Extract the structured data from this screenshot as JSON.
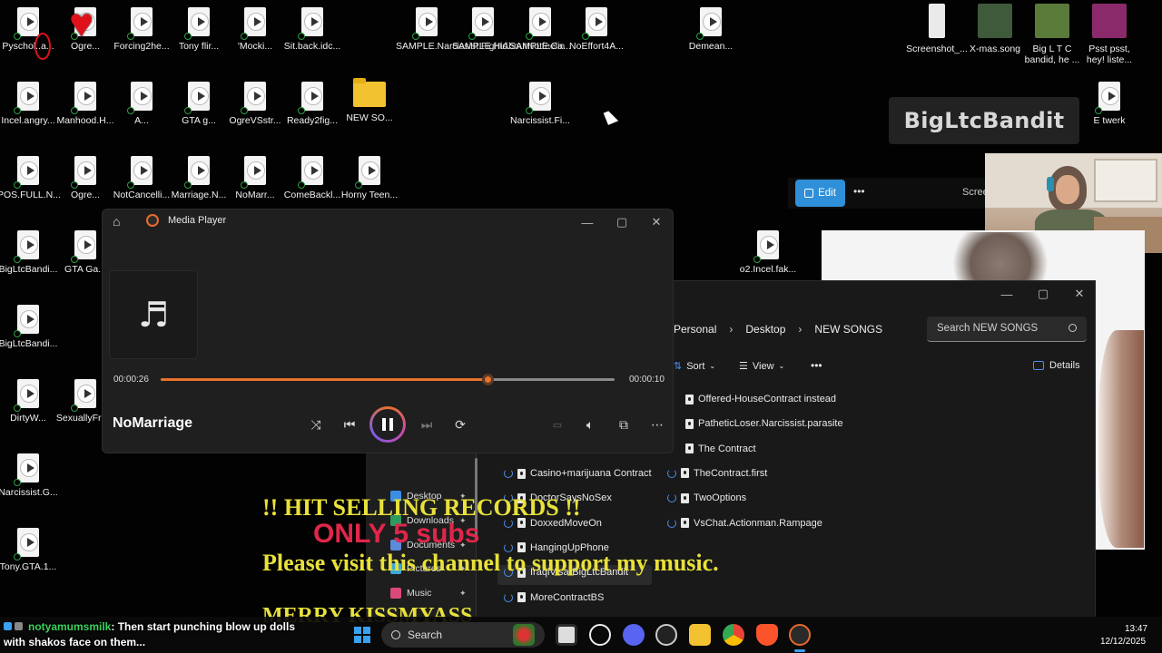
{
  "desktop_icons": [
    {
      "label": "Pyschol..a...",
      "type": "media"
    },
    {
      "label": "Ogre...",
      "type": "media",
      "overlay": "heart"
    },
    {
      "label": "Forcing2he...",
      "type": "media"
    },
    {
      "label": "Tony flir...",
      "type": "media"
    },
    {
      "label": "'Mocki...",
      "type": "media"
    },
    {
      "label": "Sit.back.idc...",
      "type": "media"
    },
    {
      "label": "SAMPLE.Narcissist.FightAboutNotfeelin",
      "type": "media"
    },
    {
      "label": "SAMPLE.Hid...",
      "type": "media"
    },
    {
      "label": "SAMPLE.Ca...",
      "type": "media"
    },
    {
      "label": "NoEffort4A...",
      "type": "media"
    },
    {
      "label": "Demean...",
      "type": "media"
    },
    {
      "label": "Screenshot_...",
      "type": "document"
    },
    {
      "label": "X-mas.song",
      "type": "image"
    },
    {
      "label": "Big L T C bandid, he ...",
      "type": "image"
    },
    {
      "label": "Psst psst, hey! liste...",
      "type": "image"
    },
    {
      "label": "Incel.angry...",
      "type": "media"
    },
    {
      "label": "Manhood.H...",
      "type": "media"
    },
    {
      "label": "A...",
      "type": "media"
    },
    {
      "label": "GTA g...",
      "type": "media"
    },
    {
      "label": "OgreVSstr...",
      "type": "media"
    },
    {
      "label": "Ready2fig...",
      "type": "media"
    },
    {
      "label": "NEW SO...",
      "type": "folder"
    },
    {
      "label": "Narcissist.Fi...",
      "type": "media"
    },
    {
      "label": "E twerk",
      "type": "media"
    },
    {
      "label": "POS.FULL.N...",
      "type": "media"
    },
    {
      "label": "Ogre...",
      "type": "media"
    },
    {
      "label": "NotCancelli...",
      "type": "media"
    },
    {
      "label": "Marriage.N...",
      "type": "media"
    },
    {
      "label": "NoMarr...",
      "type": "media"
    },
    {
      "label": "ComeBackl...",
      "type": "media"
    },
    {
      "label": "Horny Teen...",
      "type": "media"
    },
    {
      "label": "BigLtcBandi...",
      "type": "media"
    },
    {
      "label": "GTA Ga...",
      "type": "media"
    },
    {
      "label": "o2.Incel.fak...",
      "type": "media"
    },
    {
      "label": "BigLtcBandi...",
      "type": "media"
    },
    {
      "label": "DirtyW...",
      "type": "media"
    },
    {
      "label": "SexuallyFru...",
      "type": "media"
    },
    {
      "label": "Narcissist.G...",
      "type": "media"
    },
    {
      "label": "Tony.GTA.1...",
      "type": "media"
    }
  ],
  "brand_overlay": {
    "text": "BigLtcBandit"
  },
  "screenshot_tool": {
    "edit_label": "Edit",
    "more_label": "•••",
    "scree_label": "Scree"
  },
  "media_player": {
    "title": "Media Player",
    "track": "NoMarriage",
    "elapsed": "00:00:26",
    "remaining": "00:00:10",
    "progress": 0.72,
    "buttons": {
      "shuffle": "shuffle-icon",
      "prev": "previous-icon",
      "play": "pause-icon",
      "next": "next-icon",
      "repeat": "repeat-icon",
      "captions": "captions-icon",
      "volume": "volume-icon",
      "miniplayer": "miniplayer-icon",
      "more": "more-icon"
    }
  },
  "explorer": {
    "breadcrumb": [
      "Personal",
      "Desktop",
      "NEW SONGS"
    ],
    "search_placeholder": "Search NEW SONGS",
    "toolbar": {
      "sort": "Sort",
      "view": "View",
      "more": "•••",
      "details": "Details"
    },
    "nav": [
      {
        "label": "Desktop",
        "color": "#3a8ee6"
      },
      {
        "label": "Downloads",
        "color": "#2e9b5e"
      },
      {
        "label": "Documents",
        "color": "#5b8bd9"
      },
      {
        "label": "Pictures",
        "color": "#3fa7d9"
      },
      {
        "label": "Music",
        "color": "#d94a7a"
      }
    ],
    "files_left": [
      "Casino+marijuana Contract",
      "DoctorSaysNoSex",
      "DoxxedMoveOn",
      "HangingUpPhone",
      "IraqiVisa-BigLtcBandit",
      "MoreContractBS"
    ],
    "files_right": [
      "Offered-HouseContract instead",
      "PatheticLoser.Narcissist.parasite",
      "The Contract",
      "TheContract.first",
      "TwoOptions",
      "VsChat.Actionman.Rampage"
    ]
  },
  "stream_overlay": {
    "line1": "!! HIT SELLING RECORDS !!",
    "line2": "ONLY 5 subs",
    "line3": "Please visit this channel to support my music.",
    "line4": "MERRY KISSMYASS"
  },
  "chat": {
    "user": "notyamumsmilk",
    "message_part1": ": Then start punching blow up dolls",
    "message_part2": "with shakos face on them..."
  },
  "taskbar": {
    "search_label": "Search",
    "time": "13:47",
    "date": "12/12/2025"
  },
  "colors": {
    "accent": "#e8732a",
    "overlay_yellow": "#e8e13a",
    "overlay_red": "#e0264a",
    "edit_button": "#2f8fd8"
  }
}
